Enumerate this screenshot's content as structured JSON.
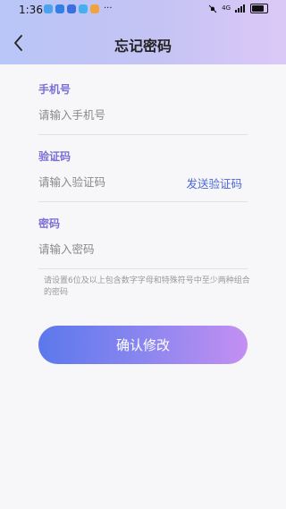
{
  "status_bar": {
    "time": "1:36",
    "more": "···",
    "network": "4G",
    "battery_level": 0.85
  },
  "header": {
    "title": "忘记密码"
  },
  "form": {
    "phone": {
      "label": "手机号",
      "placeholder": "请输入手机号",
      "value": ""
    },
    "code": {
      "label": "验证码",
      "placeholder": "请输入验证码",
      "value": "",
      "send_label": "发送验证码"
    },
    "password": {
      "label": "密码",
      "placeholder": "请输入密码",
      "value": ""
    },
    "hint": "请设置6位及以上包含数字字母和特殊符号中至少两种组合的密码"
  },
  "submit_label": "确认修改",
  "colors": {
    "label": "#7a6fd4",
    "link": "#4b69d8",
    "button_start": "#5c78ec",
    "button_end": "#c48ff2"
  },
  "status_icons": [
    "gallery-icon",
    "qq-icon",
    "chat-icon",
    "browser-icon",
    "video-icon",
    "mute-icon",
    "signal-icon",
    "battery-icon"
  ]
}
